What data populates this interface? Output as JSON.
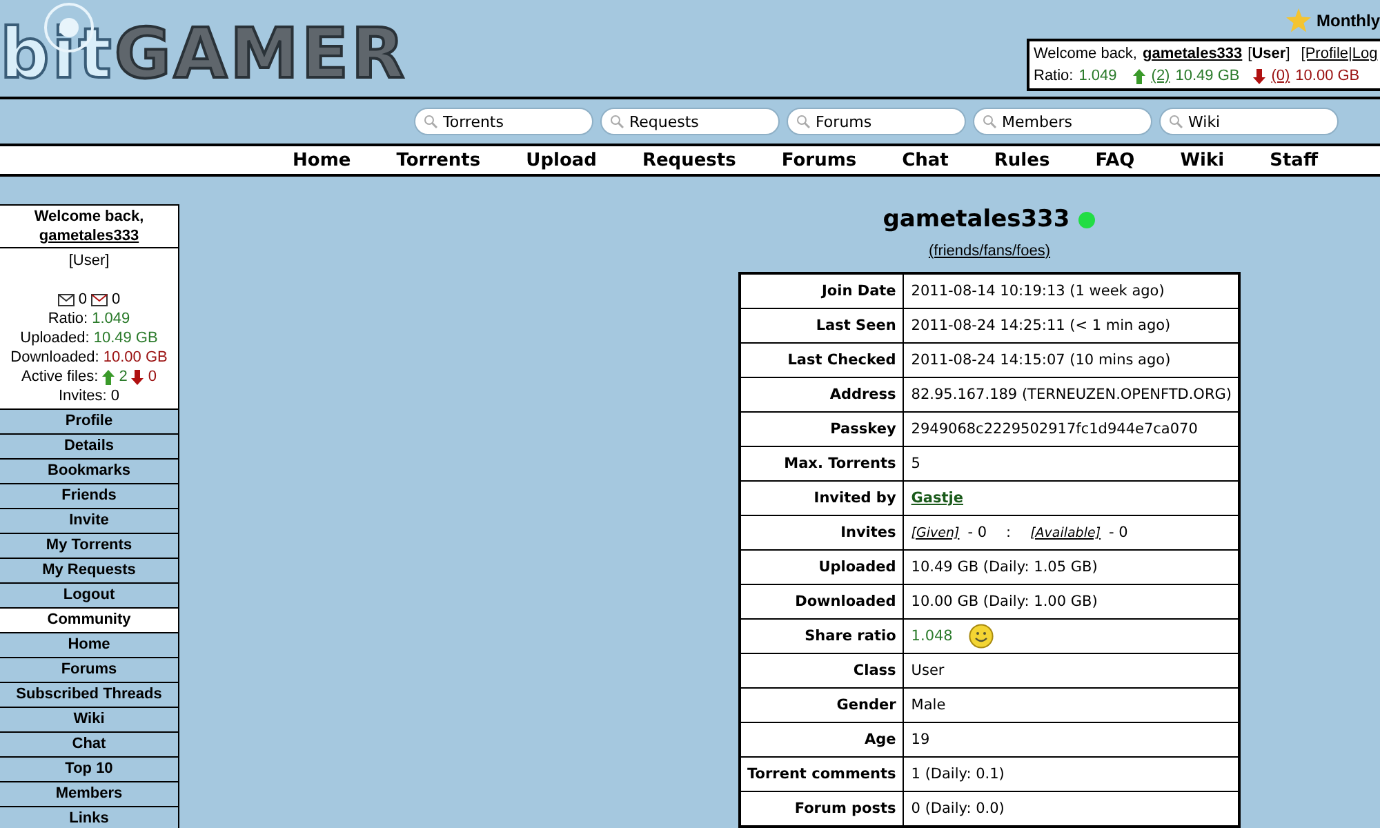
{
  "logo": {
    "part_1": "bit",
    "part_2": "GAMER"
  },
  "promo": {
    "text": "Monthly"
  },
  "userbar": {
    "greeting": "Welcome back,",
    "username": "gametales333",
    "class": "[**User**]",
    "links": "[Profile|Log",
    "ratio_label": "Ratio:",
    "ratio": "1.049",
    "up_count": "(2)",
    "uploaded": "10.49 GB",
    "down_count": "(0)",
    "downloaded": "10.00 GB"
  },
  "search_boxes": [
    {
      "placeholder": "Torrents"
    },
    {
      "placeholder": "Requests"
    },
    {
      "placeholder": "Forums"
    },
    {
      "placeholder": "Members"
    },
    {
      "placeholder": "Wiki"
    }
  ],
  "nav": [
    "Home",
    "Torrents",
    "Upload",
    "Requests",
    "Forums",
    "Chat",
    "Rules",
    "FAQ",
    "Wiki",
    "Staff"
  ],
  "sidebar": {
    "greeting": "Welcome back,",
    "username": "gametales333",
    "class": "[User]",
    "inbox": "0",
    "outbox": "0",
    "ratio_label": "Ratio:",
    "ratio": "1.049",
    "uploaded_label": "Uploaded:",
    "uploaded": "10.49 GB",
    "downloaded_label": "Downloaded:",
    "downloaded": "10.00 GB",
    "active_label": "Active files:",
    "active_up": "2",
    "active_down": "0",
    "invites": "Invites: 0",
    "items": [
      {
        "kind": "link",
        "label": "Profile"
      },
      {
        "kind": "link",
        "label": "Details"
      },
      {
        "kind": "link",
        "label": "Bookmarks"
      },
      {
        "kind": "link",
        "label": "Friends"
      },
      {
        "kind": "link",
        "label": "Invite"
      },
      {
        "kind": "link",
        "label": "My Torrents"
      },
      {
        "kind": "link",
        "label": "My Requests"
      },
      {
        "kind": "link",
        "label": "Logout"
      },
      {
        "kind": "header",
        "label": "Community"
      },
      {
        "kind": "link",
        "label": "Home"
      },
      {
        "kind": "link",
        "label": "Forums"
      },
      {
        "kind": "link",
        "label": "Subscribed Threads"
      },
      {
        "kind": "link",
        "label": "Wiki"
      },
      {
        "kind": "link",
        "label": "Chat"
      },
      {
        "kind": "link",
        "label": "Top 10"
      },
      {
        "kind": "link",
        "label": "Members"
      },
      {
        "kind": "link",
        "label": "Links"
      }
    ]
  },
  "profile": {
    "username": "gametales333",
    "online": true,
    "relations_link": "(friends/fans/foes)",
    "rows": [
      {
        "kind": "text",
        "label": "Join Date",
        "value": "2011-08-14 10:19:13 (1 week ago)"
      },
      {
        "kind": "text",
        "label": "Last Seen",
        "value": "2011-08-24 14:25:11 (< 1 min ago)"
      },
      {
        "kind": "text",
        "label": "Last Checked",
        "value": "2011-08-24 14:15:07 (10 mins ago)"
      },
      {
        "kind": "text",
        "label": "Address",
        "value": "82.95.167.189 (TERNEUZEN.OPENFTD.ORG)"
      },
      {
        "kind": "text",
        "label": "Passkey",
        "value": "2949068c2229502917fc1d944e7ca070"
      },
      {
        "kind": "text",
        "label": "Max. Torrents",
        "value": "5"
      },
      {
        "kind": "link",
        "label": "Invited by",
        "value": "Gastje"
      },
      {
        "kind": "invites",
        "label": "Invites",
        "given_link": "[Given]",
        "given": "- 0",
        "separator": ":",
        "available_link": "[Available]",
        "available": "- 0"
      },
      {
        "kind": "text",
        "label": "Uploaded",
        "value": "10.49 GB   (Daily: 1.05 GB)"
      },
      {
        "kind": "text",
        "label": "Downloaded",
        "value": "10.00 GB   (Daily: 1.00 GB)"
      },
      {
        "kind": "ratio",
        "label": "Share ratio",
        "value": "1.048"
      },
      {
        "kind": "text",
        "label": "Class",
        "value": "User"
      },
      {
        "kind": "text",
        "label": "Gender",
        "value": "Male"
      },
      {
        "kind": "text",
        "label": "Age",
        "value": "19"
      },
      {
        "kind": "text",
        "label": "Torrent comments",
        "value": "1   (Daily: 0.1)"
      },
      {
        "kind": "text",
        "label": "Forum posts",
        "value": "0   (Daily: 0.0)"
      }
    ]
  }
}
